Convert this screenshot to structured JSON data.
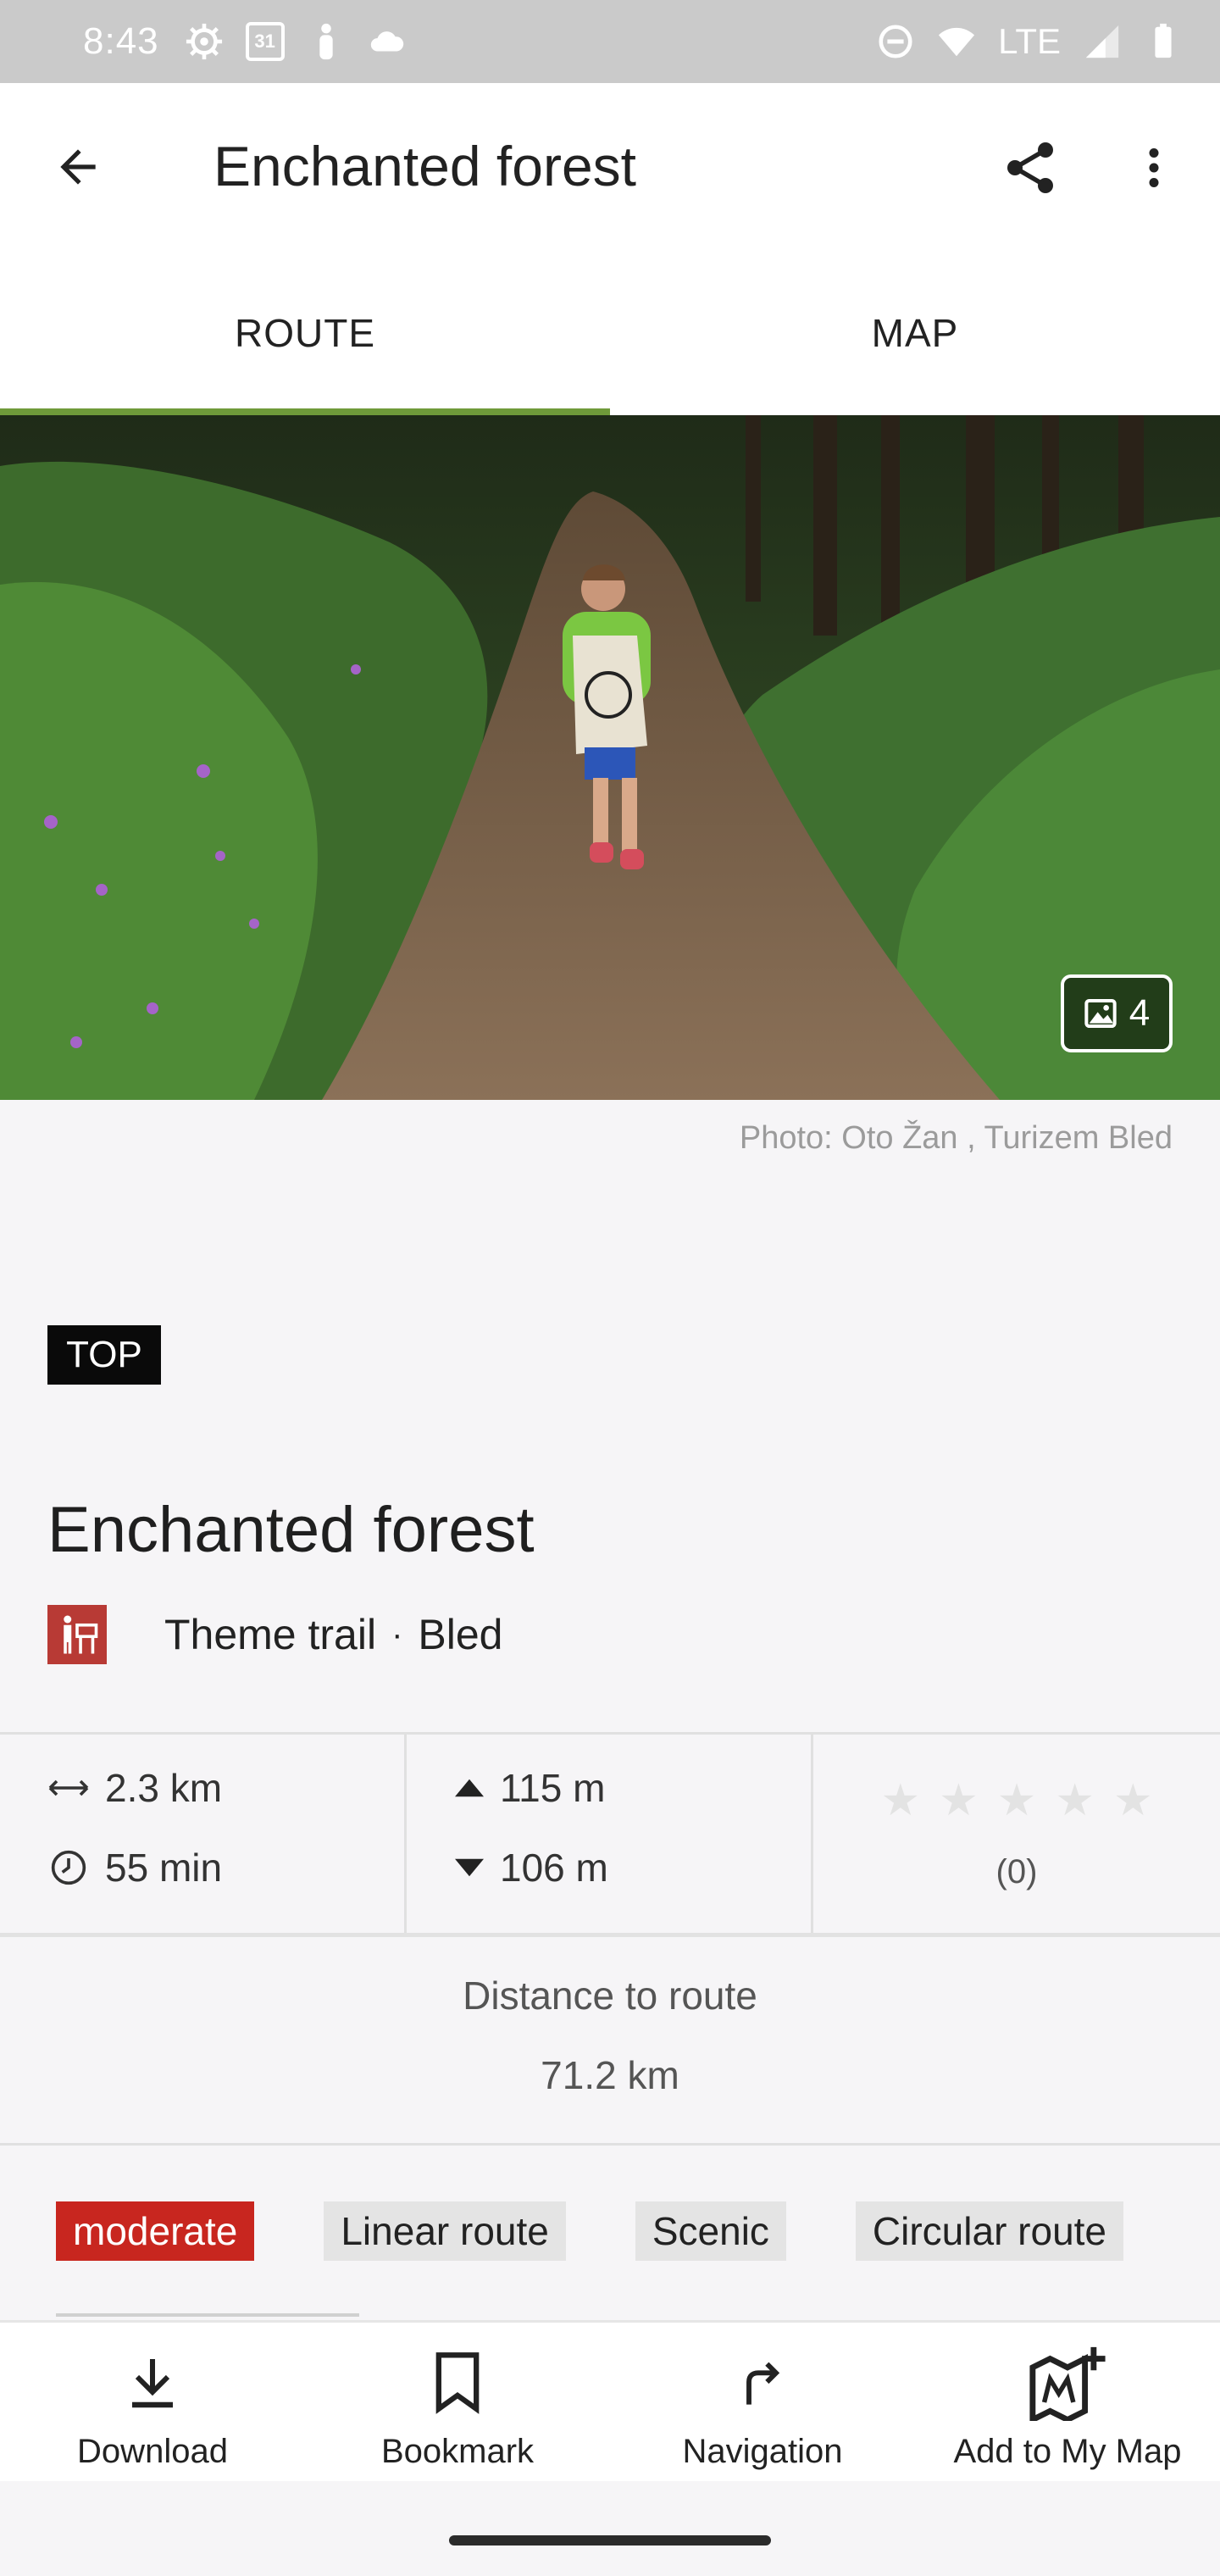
{
  "status_bar": {
    "time": "8:43",
    "calendar_day": "31",
    "network": "LTE"
  },
  "app_bar": {
    "title": "Enchanted forest",
    "back_icon": "arrow-back-icon",
    "share_icon": "share-icon",
    "more_icon": "more-vert-icon"
  },
  "tabs": [
    {
      "label": "ROUTE",
      "active": true
    },
    {
      "label": "MAP",
      "active": false
    }
  ],
  "hero": {
    "photo_count": "4",
    "credit": "Photo: Oto Žan , Turizem Bled"
  },
  "badge": "TOP",
  "route": {
    "title": "Enchanted forest",
    "category": "Theme trail",
    "separator": "·",
    "location": "Bled",
    "category_color": "#b83a35"
  },
  "stats": {
    "distance": "2.3 km",
    "duration": "55 min",
    "ascent": "115 m",
    "descent": "106 m",
    "rating_stars": 0,
    "rating_count": "(0)"
  },
  "distance_to_route": {
    "label": "Distance to route",
    "value": "71.2 km"
  },
  "tags": [
    {
      "label": "moderate",
      "type": "difficulty"
    },
    {
      "label": "Linear route",
      "type": "plain"
    },
    {
      "label": "Scenic",
      "type": "plain"
    },
    {
      "label": "Circular route",
      "type": "plain"
    }
  ],
  "actions": [
    {
      "label": "Download",
      "icon": "download-icon"
    },
    {
      "label": "Bookmark",
      "icon": "bookmark-icon"
    },
    {
      "label": "Navigation",
      "icon": "navigation-icon"
    },
    {
      "label": "Add to My Map",
      "icon": "add-to-map-icon"
    }
  ],
  "colors": {
    "accent": "#6f9a3a",
    "difficulty_moderate": "#c8261f"
  }
}
